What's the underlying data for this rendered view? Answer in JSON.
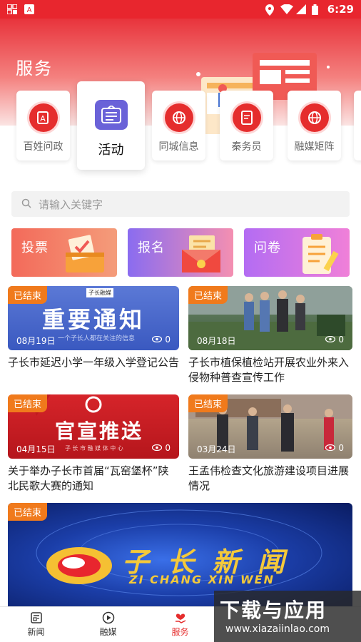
{
  "status_bar": {
    "time": "6:29"
  },
  "header": {
    "title": "服务"
  },
  "services": [
    {
      "label": "百姓问政",
      "icon": "ask-icon"
    },
    {
      "label": "活动",
      "icon": "activity-icon"
    },
    {
      "label": "同城信息",
      "icon": "globe-icon"
    },
    {
      "label": "秦务员",
      "icon": "document-icon"
    },
    {
      "label": "融媒矩阵",
      "icon": "globe-icon"
    }
  ],
  "search": {
    "placeholder": "请输入关键字"
  },
  "features": [
    {
      "label": "投票",
      "color": "#f2695b"
    },
    {
      "label": "报名",
      "color": "#8a6cf0"
    },
    {
      "label": "问卷",
      "color": "#b36cf3"
    }
  ],
  "activities": [
    {
      "status": "已结束",
      "date": "08月19日",
      "views": "0",
      "title": "子长市延迟小学一年级入学登记公告",
      "image_text": "重要通知",
      "image_tag": "子长融媒",
      "image_sub": "一个子长人都在关注的信息"
    },
    {
      "status": "已结束",
      "date": "08月18日",
      "views": "0",
      "title": "子长市植保植检站开展农业外来入侵物种普查宣传工作"
    },
    {
      "status": "已结束",
      "date": "04月15日",
      "views": "0",
      "title": "关于举办子长市首届“瓦窑堡杯”陕北民歌大赛的通知",
      "image_text": "官宣推送",
      "image_sub": "子 长 市 融 媒 体 中 心"
    },
    {
      "status": "已结束",
      "date": "03月24日",
      "views": "0",
      "title": "王孟伟检查文化旅游建设项目进展情况"
    },
    {
      "status": "已结束",
      "image_text": "子 长 新 闻",
      "image_sub": "ZI CHANG XIN WEN"
    }
  ],
  "bottom_nav": [
    {
      "label": "新闻",
      "icon": "news-icon"
    },
    {
      "label": "融媒",
      "icon": "play-icon"
    },
    {
      "label": "服务",
      "icon": "heart-hand-icon"
    },
    {
      "label": "",
      "icon": ""
    },
    {
      "label": "",
      "icon": ""
    }
  ],
  "watermark": {
    "text": "下载与应用",
    "url": "www.xiazaiinlao.com"
  },
  "colors": {
    "primary": "#e8262e",
    "badge": "#f07a1c"
  }
}
